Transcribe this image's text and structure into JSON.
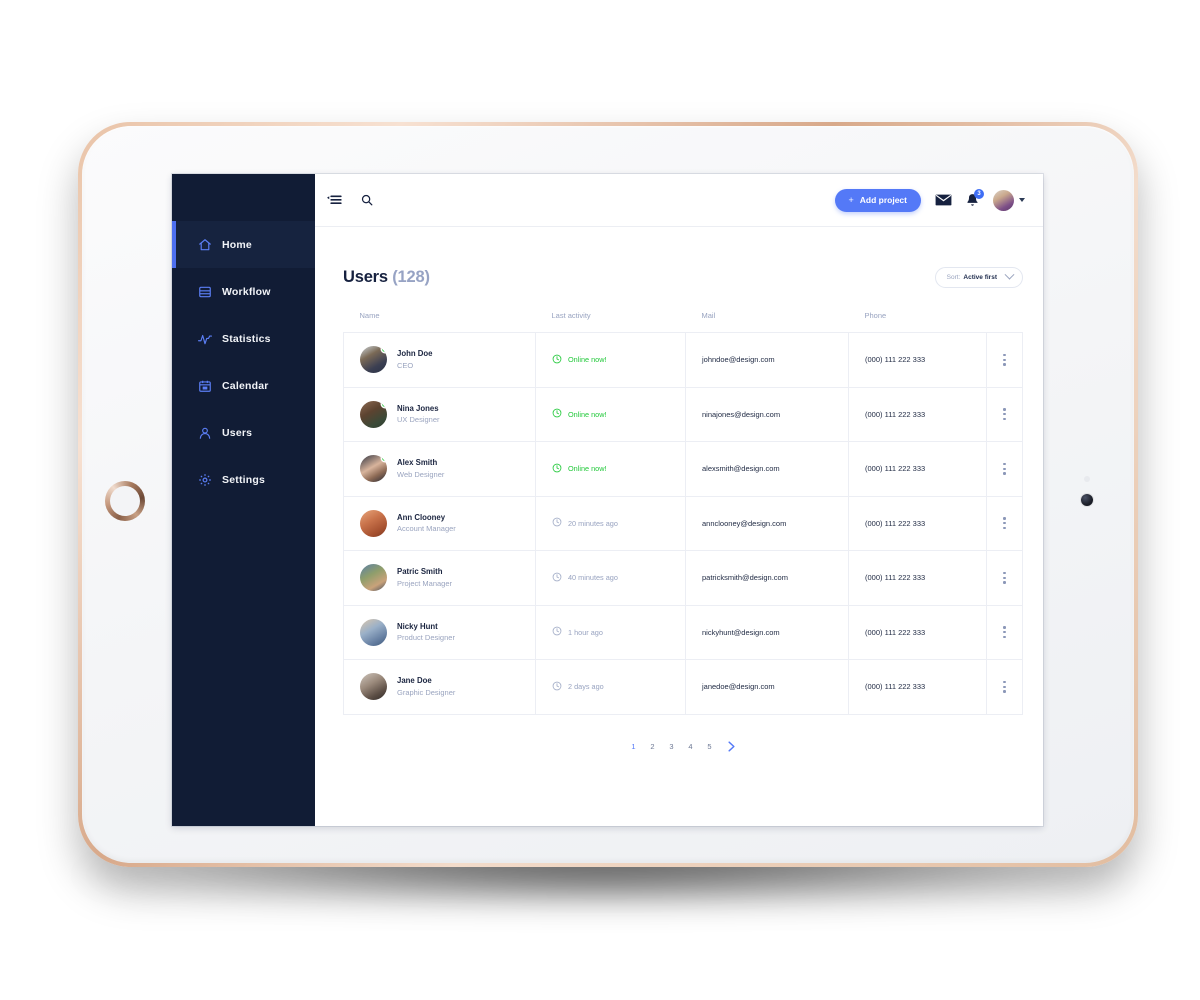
{
  "sidebar": {
    "items": [
      {
        "label": "Home",
        "icon": "home-icon",
        "active": true
      },
      {
        "label": "Workflow",
        "icon": "workflow-icon",
        "active": false
      },
      {
        "label": "Statistics",
        "icon": "statistics-icon",
        "active": false
      },
      {
        "label": "Calendar",
        "icon": "calendar-icon",
        "active": false
      },
      {
        "label": "Users",
        "icon": "users-icon",
        "active": false
      },
      {
        "label": "Settings",
        "icon": "settings-icon",
        "active": false
      }
    ]
  },
  "topbar": {
    "menu_icon": "hamburger-collapse-icon",
    "search_icon": "search-icon",
    "add_project_label": "Add project",
    "add_project_plus": "+",
    "mail_icon": "mail-icon",
    "bell_icon": "bell-icon",
    "notification_count": "3",
    "avatar_icon": "user-avatar",
    "caret_icon": "chevron-down-icon"
  },
  "page": {
    "title": "Users",
    "count": "(128)",
    "sort_label": "Sort:",
    "sort_value": "Active first"
  },
  "table": {
    "columns": [
      "Name",
      "Last activity",
      "Mail",
      "Phone"
    ],
    "rows": [
      {
        "name": "John Doe",
        "role": "CEO",
        "activity": "Online now!",
        "online": true,
        "mail": "johndoe@design.com",
        "phone": "(000) 111 222 333"
      },
      {
        "name": "Nina Jones",
        "role": "UX Designer",
        "activity": "Online now!",
        "online": true,
        "mail": "ninajones@design.com",
        "phone": "(000) 111 222 333"
      },
      {
        "name": "Alex Smith",
        "role": "Web Designer",
        "activity": "Online now!",
        "online": true,
        "mail": "alexsmith@design.com",
        "phone": "(000) 111 222 333"
      },
      {
        "name": "Ann Clooney",
        "role": "Account Manager",
        "activity": "20 minutes ago",
        "online": false,
        "mail": "annclooney@design.com",
        "phone": "(000) 111 222 333"
      },
      {
        "name": "Patric Smith",
        "role": "Project Manager",
        "activity": "40 minutes ago",
        "online": false,
        "mail": "patricksmith@design.com",
        "phone": "(000) 111 222 333"
      },
      {
        "name": "Nicky Hunt",
        "role": "Product Designer",
        "activity": "1 hour ago",
        "online": false,
        "mail": "nickyhunt@design.com",
        "phone": "(000) 111 222 333"
      },
      {
        "name": "Jane Doe",
        "role": "Graphic Designer",
        "activity": "2 days ago",
        "online": false,
        "mail": "janedoe@design.com",
        "phone": "(000) 111 222 333"
      }
    ]
  },
  "pagination": {
    "pages": [
      "1",
      "2",
      "3",
      "4",
      "5"
    ],
    "active": "1",
    "next_icon": "chevron-right-icon"
  },
  "colors": {
    "sidebar_bg": "#111c35",
    "accent_blue": "#5479f7",
    "online_green": "#22c93a",
    "muted_text": "#98a3c0",
    "title_text": "#16213f",
    "device_rim": "#e2bda0"
  }
}
